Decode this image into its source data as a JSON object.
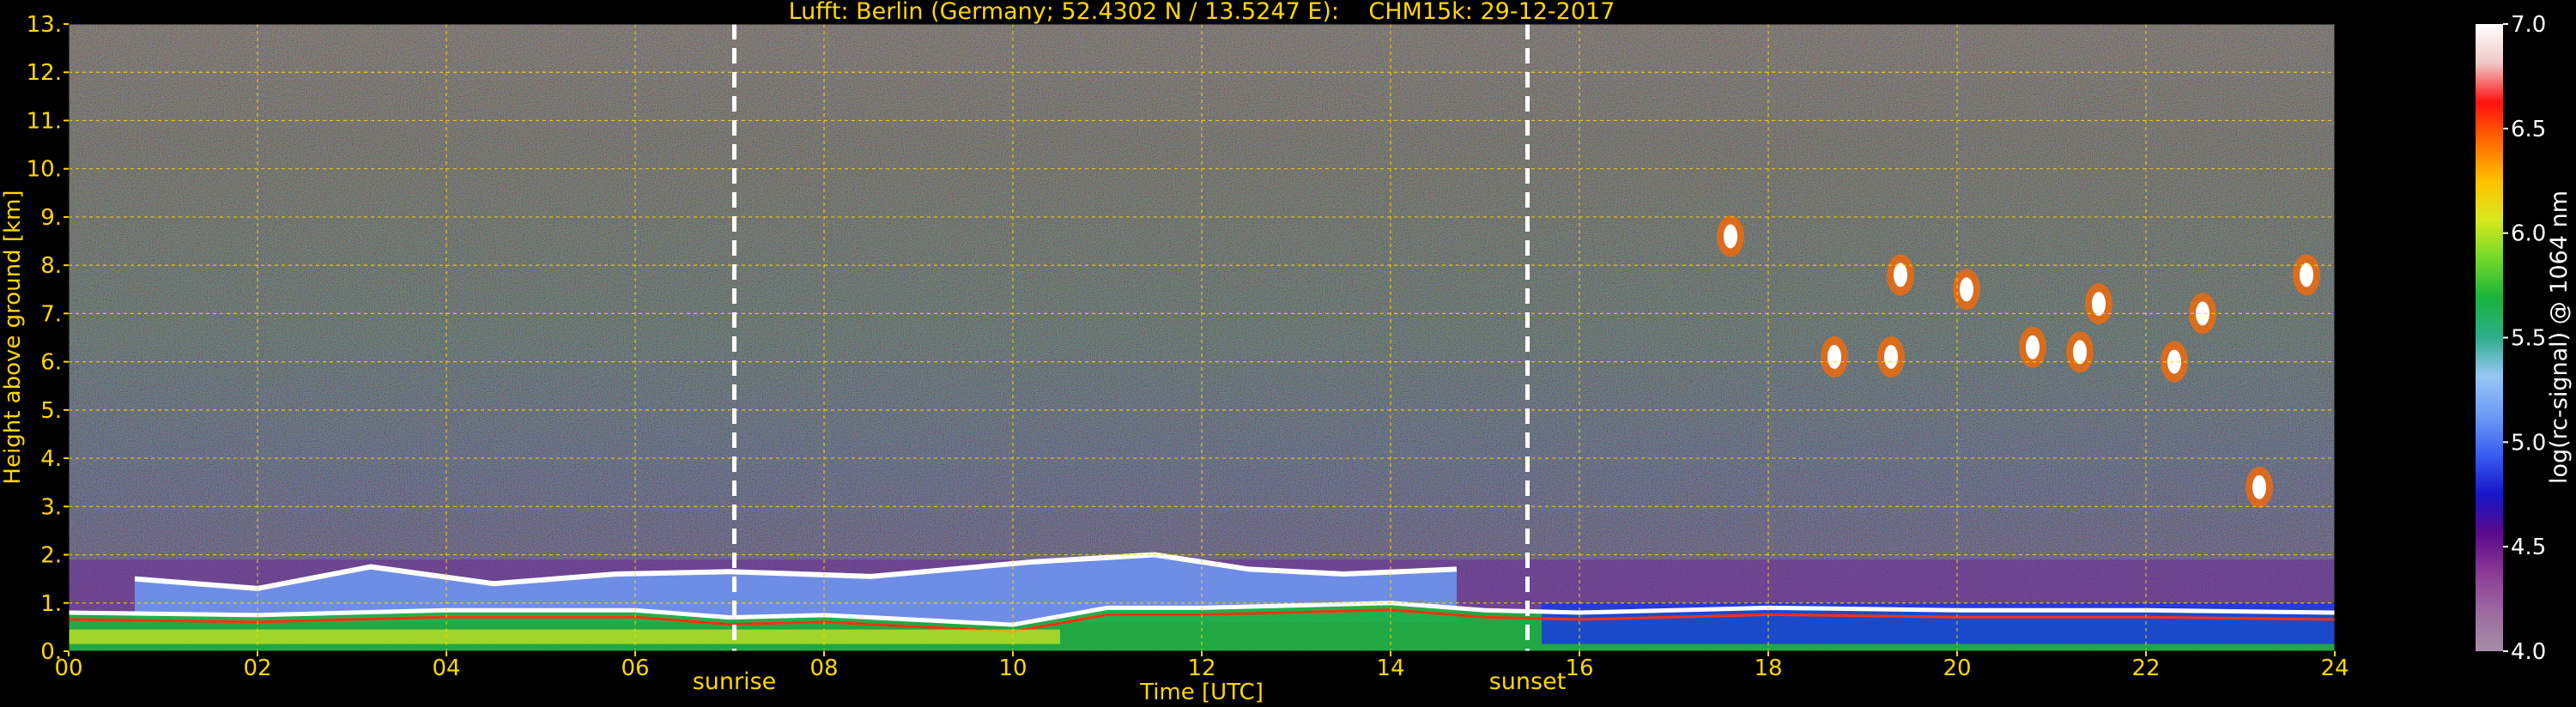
{
  "chart_data": {
    "type": "heatmap",
    "title": "Lufft: Berlin (Germany; 52.4302 N / 13.5247 E):    CHM15k: 29-12-2017",
    "xlabel": "Time [UTC]",
    "ylabel": "Height above ground [km]",
    "xlim": [
      0,
      24
    ],
    "ylim": [
      0,
      13
    ],
    "x_ticks": [
      "00",
      "02",
      "04",
      "06",
      "08",
      "10",
      "12",
      "14",
      "16",
      "18",
      "20",
      "22",
      "24"
    ],
    "y_ticks": [
      "0.",
      "1.",
      "2.",
      "3.",
      "4.",
      "5.",
      "6.",
      "7.",
      "8.",
      "9.",
      "10.",
      "11.",
      "12.",
      "13."
    ],
    "grid": true,
    "annotations": [
      {
        "text": "sunrise",
        "x": 7.05
      },
      {
        "text": "sunset",
        "x": 15.45
      }
    ],
    "colorbar": {
      "label": "log(rc-signal) @ 1064 nm",
      "range": [
        4.0,
        7.0
      ],
      "ticks": [
        "4.0",
        "4.5",
        "5.0",
        "5.5",
        "6.0",
        "6.5",
        "7.0"
      ],
      "colors": [
        "#a58ea5",
        "#9c6aa0",
        "#8a3a95",
        "#5a0a8a",
        "#1515c8",
        "#3a5df0",
        "#6e9af5",
        "#98c6f5",
        "#2fae8c",
        "#19b23c",
        "#72d82a",
        "#d8e81e",
        "#ffc000",
        "#ff6a00",
        "#ff1010",
        "#f0c8c8",
        "#ffffff"
      ]
    },
    "features": {
      "boundary_layer_top_km": {
        "x": [
          0,
          2,
          4,
          6,
          7,
          8,
          10,
          11,
          12,
          13,
          14,
          15,
          16,
          18,
          20,
          22,
          24
        ],
        "y": [
          0.8,
          0.75,
          0.85,
          0.85,
          0.7,
          0.75,
          0.55,
          0.9,
          0.9,
          0.95,
          1.0,
          0.85,
          0.8,
          0.9,
          0.85,
          0.85,
          0.8
        ]
      },
      "residual_layer_top_km": {
        "x": [
          0.7,
          2,
          3.2,
          4.5,
          5.8,
          7.0,
          8.5,
          10.2,
          11.5,
          12.5,
          13.5,
          14.7
        ],
        "y": [
          1.5,
          1.3,
          1.75,
          1.4,
          1.6,
          1.65,
          1.55,
          1.85,
          2.0,
          1.7,
          1.6,
          1.7
        ]
      },
      "cirrus_clouds": [
        {
          "t": 17.6,
          "h": 8.6
        },
        {
          "t": 18.7,
          "h": 6.1
        },
        {
          "t": 19.3,
          "h": 6.1
        },
        {
          "t": 19.4,
          "h": 7.8
        },
        {
          "t": 20.1,
          "h": 7.5
        },
        {
          "t": 20.8,
          "h": 6.3
        },
        {
          "t": 21.3,
          "h": 6.2
        },
        {
          "t": 21.5,
          "h": 7.2
        },
        {
          "t": 22.3,
          "h": 6.0
        },
        {
          "t": 22.6,
          "h": 7.0
        },
        {
          "t": 23.2,
          "h": 3.4
        },
        {
          "t": 23.7,
          "h": 7.8
        }
      ]
    }
  }
}
